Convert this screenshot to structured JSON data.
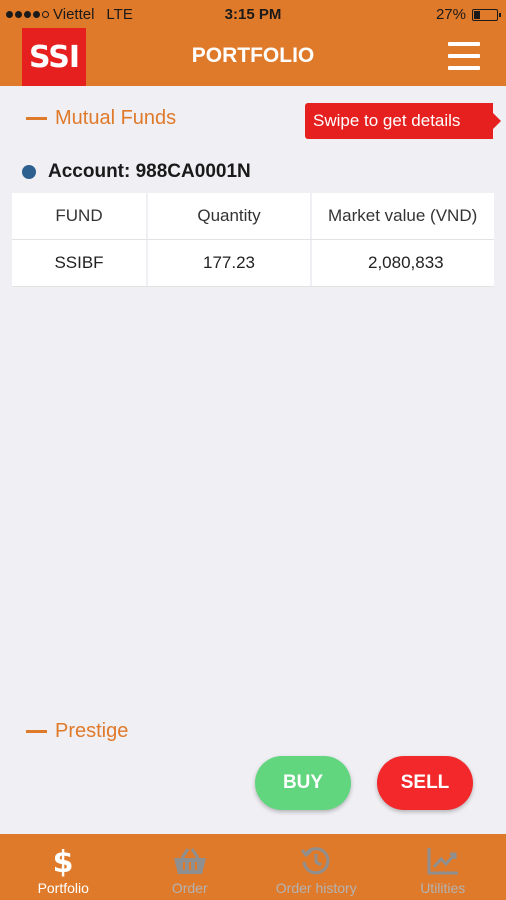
{
  "status_bar": {
    "carrier": "Viettel",
    "network": "LTE",
    "time": "3:15 PM",
    "battery": "27%",
    "battery_level": 0.27
  },
  "header": {
    "logo": "SSI",
    "title": "PORTFOLIO",
    "menu_icon": "hamburger-menu-icon"
  },
  "mutual_funds": {
    "heading": "Mutual Funds",
    "swipe_hint": "Swipe to get details",
    "account_label": "Account: 988CA0001N",
    "columns": [
      "FUND",
      "Quantity",
      "Market value (VND)"
    ],
    "rows": [
      {
        "fund": "SSIBF",
        "quantity": "177.23",
        "market_value": "2,080,833"
      }
    ]
  },
  "prestige": {
    "heading": "Prestige"
  },
  "actions": {
    "buy": "BUY",
    "sell": "SELL"
  },
  "tabs": [
    {
      "label": "Portfolio",
      "icon": "dollar-icon",
      "active": true
    },
    {
      "label": "Order",
      "icon": "basket-icon",
      "active": false
    },
    {
      "label": "Order history",
      "icon": "history-icon",
      "active": false
    },
    {
      "label": "Utilities",
      "icon": "chart-icon",
      "active": false
    }
  ],
  "colors": {
    "brand_orange": "#e07a2b",
    "brand_red": "#e5201e",
    "buy_green": "#62d57f",
    "sell_red": "#f2282b",
    "account_dot": "#2d5f8f"
  }
}
